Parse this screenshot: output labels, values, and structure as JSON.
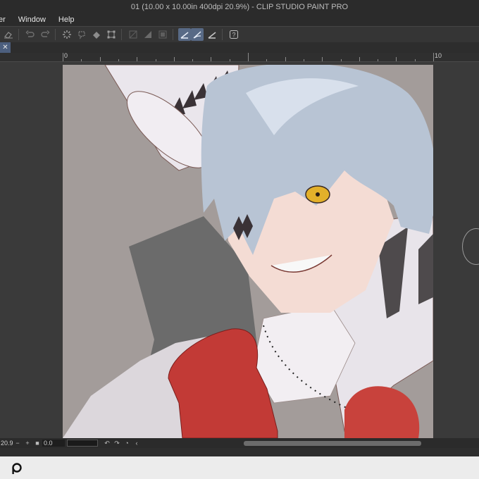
{
  "window": {
    "title": "01 (10.00 x 10.00in 400dpi 20.9%)  - CLIP STUDIO PAINT PRO"
  },
  "menu": {
    "items": [
      "er",
      "Window",
      "Help"
    ]
  },
  "toolbar": {
    "icons": [
      "eraser-icon",
      "undo-icon",
      "redo-icon",
      "loading-icon",
      "lasso-icon",
      "fill-icon",
      "transform-icon",
      "grid-icon",
      "gradient-icon",
      "frame-icon",
      "ruler-icon",
      "snap-icon",
      "pen-ruler-icon",
      "help-icon"
    ]
  },
  "tab": {
    "close_label": "✕"
  },
  "ruler": {
    "mark_0": "0",
    "mark_10": "10"
  },
  "status": {
    "zoom": "20.9",
    "rotation_value": "0.0",
    "icons": [
      "zoom-out-icon",
      "zoom-in-icon",
      "fit-icon",
      "rotate-left-icon",
      "rotate-right-icon",
      "reset-rotate-icon",
      "flip-icon"
    ]
  },
  "colors": {
    "app_bg": "#3a3a3a",
    "active_tool": "#586a86",
    "canvas_bg": "#a39c9a",
    "taskbar": "#ececec"
  }
}
